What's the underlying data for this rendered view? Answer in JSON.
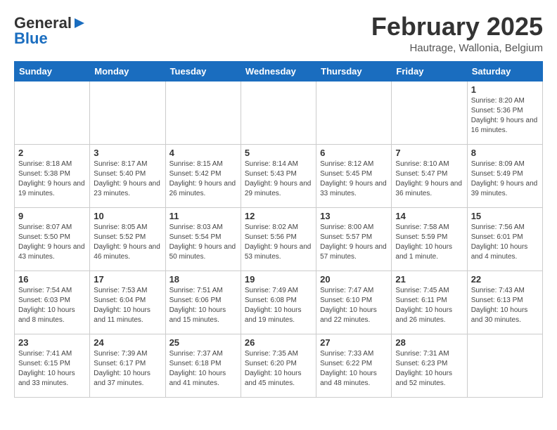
{
  "header": {
    "logo_general": "General",
    "logo_blue": "Blue",
    "month_year": "February 2025",
    "location": "Hautrage, Wallonia, Belgium"
  },
  "days_of_week": [
    "Sunday",
    "Monday",
    "Tuesday",
    "Wednesday",
    "Thursday",
    "Friday",
    "Saturday"
  ],
  "weeks": [
    [
      {
        "day": "",
        "info": ""
      },
      {
        "day": "",
        "info": ""
      },
      {
        "day": "",
        "info": ""
      },
      {
        "day": "",
        "info": ""
      },
      {
        "day": "",
        "info": ""
      },
      {
        "day": "",
        "info": ""
      },
      {
        "day": "1",
        "info": "Sunrise: 8:20 AM\nSunset: 5:36 PM\nDaylight: 9 hours and 16 minutes."
      }
    ],
    [
      {
        "day": "2",
        "info": "Sunrise: 8:18 AM\nSunset: 5:38 PM\nDaylight: 9 hours and 19 minutes."
      },
      {
        "day": "3",
        "info": "Sunrise: 8:17 AM\nSunset: 5:40 PM\nDaylight: 9 hours and 23 minutes."
      },
      {
        "day": "4",
        "info": "Sunrise: 8:15 AM\nSunset: 5:42 PM\nDaylight: 9 hours and 26 minutes."
      },
      {
        "day": "5",
        "info": "Sunrise: 8:14 AM\nSunset: 5:43 PM\nDaylight: 9 hours and 29 minutes."
      },
      {
        "day": "6",
        "info": "Sunrise: 8:12 AM\nSunset: 5:45 PM\nDaylight: 9 hours and 33 minutes."
      },
      {
        "day": "7",
        "info": "Sunrise: 8:10 AM\nSunset: 5:47 PM\nDaylight: 9 hours and 36 minutes."
      },
      {
        "day": "8",
        "info": "Sunrise: 8:09 AM\nSunset: 5:49 PM\nDaylight: 9 hours and 39 minutes."
      }
    ],
    [
      {
        "day": "9",
        "info": "Sunrise: 8:07 AM\nSunset: 5:50 PM\nDaylight: 9 hours and 43 minutes."
      },
      {
        "day": "10",
        "info": "Sunrise: 8:05 AM\nSunset: 5:52 PM\nDaylight: 9 hours and 46 minutes."
      },
      {
        "day": "11",
        "info": "Sunrise: 8:03 AM\nSunset: 5:54 PM\nDaylight: 9 hours and 50 minutes."
      },
      {
        "day": "12",
        "info": "Sunrise: 8:02 AM\nSunset: 5:56 PM\nDaylight: 9 hours and 53 minutes."
      },
      {
        "day": "13",
        "info": "Sunrise: 8:00 AM\nSunset: 5:57 PM\nDaylight: 9 hours and 57 minutes."
      },
      {
        "day": "14",
        "info": "Sunrise: 7:58 AM\nSunset: 5:59 PM\nDaylight: 10 hours and 1 minute."
      },
      {
        "day": "15",
        "info": "Sunrise: 7:56 AM\nSunset: 6:01 PM\nDaylight: 10 hours and 4 minutes."
      }
    ],
    [
      {
        "day": "16",
        "info": "Sunrise: 7:54 AM\nSunset: 6:03 PM\nDaylight: 10 hours and 8 minutes."
      },
      {
        "day": "17",
        "info": "Sunrise: 7:53 AM\nSunset: 6:04 PM\nDaylight: 10 hours and 11 minutes."
      },
      {
        "day": "18",
        "info": "Sunrise: 7:51 AM\nSunset: 6:06 PM\nDaylight: 10 hours and 15 minutes."
      },
      {
        "day": "19",
        "info": "Sunrise: 7:49 AM\nSunset: 6:08 PM\nDaylight: 10 hours and 19 minutes."
      },
      {
        "day": "20",
        "info": "Sunrise: 7:47 AM\nSunset: 6:10 PM\nDaylight: 10 hours and 22 minutes."
      },
      {
        "day": "21",
        "info": "Sunrise: 7:45 AM\nSunset: 6:11 PM\nDaylight: 10 hours and 26 minutes."
      },
      {
        "day": "22",
        "info": "Sunrise: 7:43 AM\nSunset: 6:13 PM\nDaylight: 10 hours and 30 minutes."
      }
    ],
    [
      {
        "day": "23",
        "info": "Sunrise: 7:41 AM\nSunset: 6:15 PM\nDaylight: 10 hours and 33 minutes."
      },
      {
        "day": "24",
        "info": "Sunrise: 7:39 AM\nSunset: 6:17 PM\nDaylight: 10 hours and 37 minutes."
      },
      {
        "day": "25",
        "info": "Sunrise: 7:37 AM\nSunset: 6:18 PM\nDaylight: 10 hours and 41 minutes."
      },
      {
        "day": "26",
        "info": "Sunrise: 7:35 AM\nSunset: 6:20 PM\nDaylight: 10 hours and 45 minutes."
      },
      {
        "day": "27",
        "info": "Sunrise: 7:33 AM\nSunset: 6:22 PM\nDaylight: 10 hours and 48 minutes."
      },
      {
        "day": "28",
        "info": "Sunrise: 7:31 AM\nSunset: 6:23 PM\nDaylight: 10 hours and 52 minutes."
      },
      {
        "day": "",
        "info": ""
      }
    ]
  ]
}
